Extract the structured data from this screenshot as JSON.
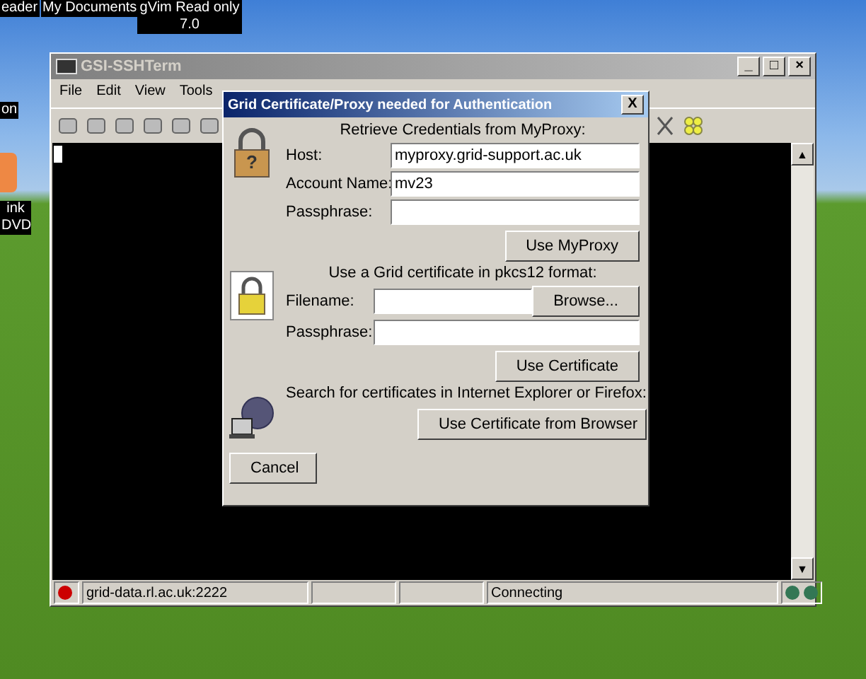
{
  "desktop_icons": [
    {
      "label": "eader",
      "kind": "top"
    },
    {
      "label": "My Documents",
      "kind": "top"
    },
    {
      "label": "gVim Read only 7.0",
      "kind": "top"
    },
    {
      "label": "on",
      "kind": "left"
    },
    {
      "label": "ink DVD",
      "kind": "left"
    }
  ],
  "window": {
    "title": "GSI-SSHTerm",
    "controls": [
      "_",
      "□",
      "×"
    ],
    "scroll": [
      "▲",
      "▼"
    ],
    "menu": [
      "File",
      "Edit",
      "View",
      "Tools"
    ],
    "status_bar": {
      "host": "grid-data.rl.ac.uk:2222",
      "status": "Connecting"
    }
  },
  "dialog": {
    "title": "Grid Certificate/Proxy needed for Authentication",
    "close": "X",
    "myproxy": {
      "heading": "Retrieve Credentials from MyProxy:",
      "fields": [
        {
          "label": "Host:",
          "value": "myproxy.grid-support.ac.uk"
        },
        {
          "label": "Account Name:",
          "value": "mv23"
        },
        {
          "label": "Passphrase:"
        }
      ],
      "button": "Use MyProxy",
      "icon_mark": "?"
    },
    "certificate": {
      "heading": "Use a Grid certificate in pkcs12 format:",
      "filename_label": "Filename:",
      "browse": "Browse...",
      "passphrase_label": "Passphrase:",
      "button": "Use Certificate"
    },
    "browser": {
      "heading": "Search for certificates in Internet Explorer or Firefox:",
      "button": "Use Certificate from Browser"
    },
    "cancel": "Cancel"
  }
}
